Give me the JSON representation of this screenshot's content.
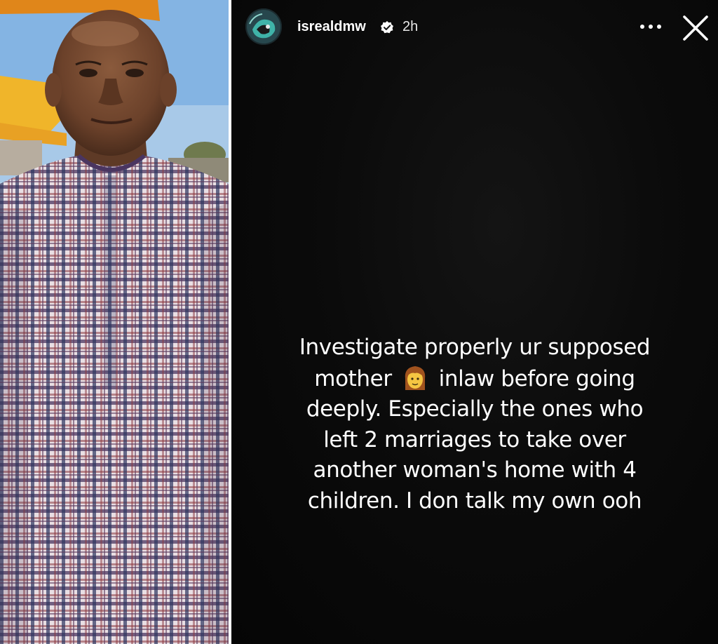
{
  "story": {
    "username": "isrealdmw",
    "timestamp": "2h",
    "more_label": "•••",
    "text": {
      "line1": "Investigate properly ur supposed",
      "line2_before": "mother",
      "line2_emoji": "woman-emoji",
      "line2_after": "inlaw before going",
      "line3": "deeply. Especially the ones who",
      "line4": "left 2 marriages to take over",
      "line5": "another woman's home with 4",
      "line6": "children. I don talk my own ooh"
    }
  },
  "icons": {
    "verified": "verified-badge-icon",
    "more": "more-options-icon",
    "close": "close-icon",
    "emoji": "woman-emoji-icon"
  },
  "colors": {
    "story_background": "#0b0b0b",
    "text": "#ffffff",
    "plaid_purple": "#5b3a5e",
    "plaid_navy": "#2c3560",
    "plaid_red": "#8c3a42"
  }
}
